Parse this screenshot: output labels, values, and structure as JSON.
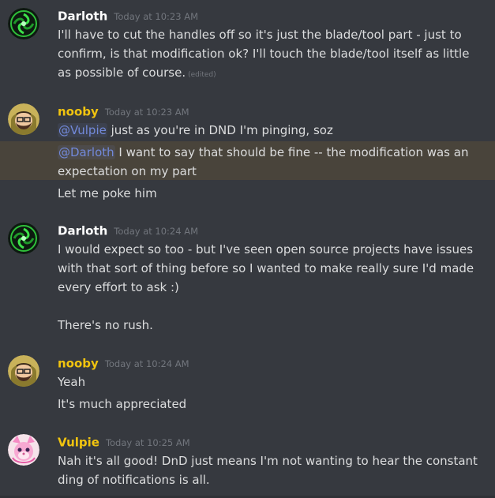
{
  "colors": {
    "background": "#36393f",
    "darloth_name": "#ffffff",
    "nooby_name": "#f1c40f",
    "vulpie_name": "#f1c40f",
    "mention": "#7289da",
    "timestamp": "#72767d"
  },
  "messages": [
    {
      "author": "Darloth",
      "timestamp": "Today at 10:23 AM",
      "avatar": "green-swirl-avatar",
      "lines": [
        "I'll have to cut the handles off so it's just the blade/tool part - just to",
        "confirm, is that modification ok?  I'll touch the blade/tool itself as little",
        "as possible of course."
      ],
      "edited": "(edited)"
    },
    {
      "author": "nooby",
      "timestamp": "Today at 10:23 AM",
      "avatar": "hooded-bearded-avatar",
      "m1_mention": "@Vulpie",
      "m1_text": " just as you're in DND I'm pinging, soz",
      "m2_mention": "@Darloth",
      "m2_text": " I want to say that should be fine -- the modification was an",
      "m2_line2": "expectation on my part",
      "m3": "Let me poke him"
    },
    {
      "author": "Darloth",
      "timestamp": "Today at 10:24 AM",
      "avatar": "green-swirl-avatar",
      "lines": [
        "I would expect so too - but I've seen open source projects have issues",
        "with that sort of thing before so I wanted to make really sure I'd made",
        "every effort to ask :)",
        "There's no rush."
      ]
    },
    {
      "author": "nooby",
      "timestamp": "Today at 10:24 AM",
      "avatar": "hooded-bearded-avatar",
      "lines": [
        "Yeah",
        "It's much appreciated"
      ]
    },
    {
      "author": "Vulpie",
      "timestamp": "Today at 10:25 AM",
      "avatar": "pink-fox-avatar",
      "lines": [
        "Nah it's all good! DnD just means I'm not wanting to hear the constant",
        "ding of notifications is all."
      ]
    }
  ]
}
